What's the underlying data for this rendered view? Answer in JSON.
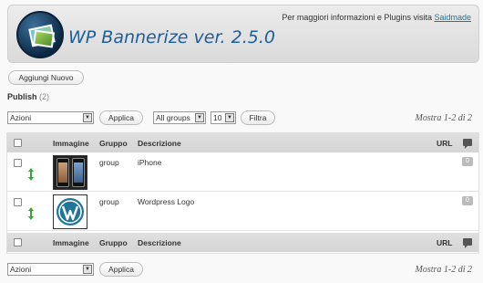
{
  "header": {
    "title": "WP Bannerize ver. 2.5.0",
    "info_text": "Per maggiori informazioni e Plugins visita",
    "info_link": "Saidmade"
  },
  "add_new_label": "Aggiungi Nuovo",
  "publish": {
    "label": "Publish",
    "count": "(2)"
  },
  "top_toolbar": {
    "bulk_action": "Azioni",
    "apply_label": "Applica",
    "group_filter": "All groups",
    "per_page": "10",
    "filter_label": "Filtra",
    "pagination": "Mostra 1-2 di 2"
  },
  "table": {
    "columns": [
      "Immagine",
      "Gruppo",
      "Descrizione",
      "URL"
    ],
    "rows": [
      {
        "group": "group",
        "description": "iPhone",
        "comments": "0",
        "image": "iphone-banner"
      },
      {
        "group": "group",
        "description": "Wordpress Logo",
        "comments": "0",
        "image": "wordpress-logo"
      }
    ]
  },
  "bottom_toolbar": {
    "bulk_action": "Azioni",
    "apply_label": "Applica",
    "pagination": "Mostra 1-2 di 2"
  },
  "colors": {
    "link": "#21759b",
    "title": "#1e5e9b",
    "header_bg": "#dadada",
    "drag_arrow": "#3aa43a"
  }
}
